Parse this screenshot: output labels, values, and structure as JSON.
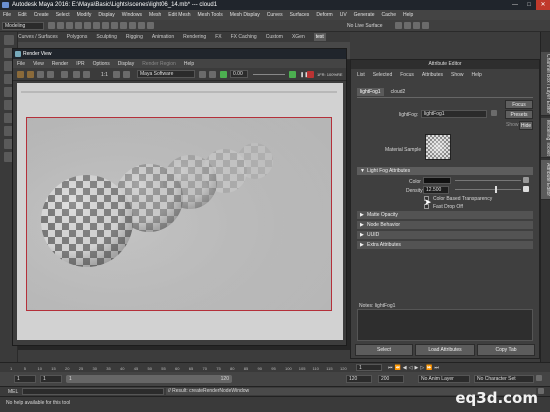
{
  "window": {
    "title": "Autodesk Maya 2016: E:\\Maya\\Basic\\Lights\\scenes\\light06_14.mb* --- cloud1",
    "minimize": "—",
    "maximize": "□",
    "close": "✕"
  },
  "menubar": [
    "File",
    "Edit",
    "Create",
    "Select",
    "Modify",
    "Display",
    "Windows",
    "Mesh",
    "Edit Mesh",
    "Mesh Tools",
    "Mesh Display",
    "Curves",
    "Surfaces",
    "Deform",
    "UV",
    "Generate",
    "Cache",
    "Help"
  ],
  "status_line": {
    "mode": "Modeling",
    "live_surface": "No Live Surface"
  },
  "shelf_tabs": [
    "Curves / Surfaces",
    "Polygons",
    "Sculpting",
    "Rigging",
    "Animation",
    "Rendering",
    "FX",
    "FX Caching",
    "Custom",
    "XGen",
    "test"
  ],
  "shelf_active": "test",
  "render_view": {
    "title": "Render View",
    "menu": [
      "File",
      "View",
      "Render",
      "IPR",
      "Options",
      "Display",
      "Render Region",
      "Help"
    ],
    "renderer": "Maya Software",
    "exposure": "0.00",
    "ratio": "1:1",
    "status": "1FR: 100%RE"
  },
  "attribute_editor": {
    "panel_title": "Attribute Editor",
    "menu": [
      "List",
      "Selected",
      "Focus",
      "Attributes",
      "Show",
      "Help"
    ],
    "tabs": [
      "lightFog1",
      "cloud2"
    ],
    "node_label": "lightFog:",
    "node_value": "lightFog1",
    "focus": "Focus",
    "presets": "Presets",
    "show": "Show",
    "hide": "Hide",
    "material_sample": "Material Sample",
    "section_open": "Light Fog Attributes",
    "color_label": "Color",
    "density_label": "Density",
    "density_value": "12.500",
    "density_level": 0.62,
    "color_based_transparency": "Color Based Transparency",
    "fast_drop_off": "Fast Drop Off",
    "sections": [
      "Matte Opacity",
      "Node Behavior",
      "UUID",
      "Extra Attributes"
    ],
    "notes_label": "Notes: lightFog1",
    "select": "Select",
    "load_attributes": "Load Attributes",
    "copy_tab": "Copy Tab"
  },
  "right_tabs": [
    "Channel Box / Layer Editor",
    "Modeling Toolkit",
    "Attribute Editor"
  ],
  "timeline": {
    "ticks": [
      "1",
      "5",
      "10",
      "15",
      "20",
      "25",
      "30",
      "35",
      "40",
      "45",
      "50",
      "55",
      "60",
      "65",
      "70",
      "75",
      "80",
      "85",
      "90",
      "95",
      "100",
      "105",
      "110",
      "115",
      "120"
    ],
    "current": "1"
  },
  "range": {
    "start": "1",
    "inner_start": "1",
    "inner_end": "120",
    "end_a": "120",
    "end_b": "200",
    "anim_layer": "No Anim Layer",
    "char_set": "No Character Set"
  },
  "command_line": {
    "lang": "MEL",
    "result": "// Result: createRenderNodeWindow"
  },
  "help_line": "No help available for this tool",
  "watermark": "eq3d.com",
  "colors": {
    "frame_border": "#b4303a",
    "accent": "#4aa3d8"
  }
}
